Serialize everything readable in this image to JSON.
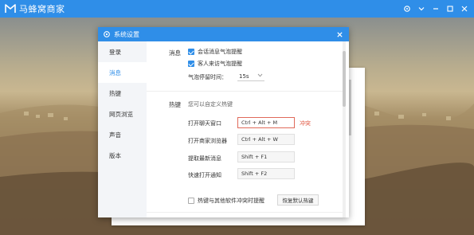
{
  "app": {
    "title": "马蜂窝商家"
  },
  "dialog": {
    "title": "系统设置"
  },
  "sidebar": {
    "items": [
      {
        "label": "登录",
        "active": false
      },
      {
        "label": "消息",
        "active": true
      },
      {
        "label": "热键",
        "active": false
      },
      {
        "label": "网页浏览",
        "active": false
      },
      {
        "label": "声音",
        "active": false
      },
      {
        "label": "版本",
        "active": false
      }
    ]
  },
  "messages": {
    "section_label": "消息",
    "option1": {
      "label": "会话消息气泡提醒",
      "checked": true
    },
    "option2": {
      "label": "客人来访气泡提醒",
      "checked": true
    },
    "bubble_time_label": "气泡停留时间：",
    "bubble_time_value": "15s"
  },
  "hotkeys": {
    "section_label": "热键",
    "hint": "您可以自定义热键",
    "rows": [
      {
        "label": "打开聊天窗口",
        "value": "Ctrl + Alt + M",
        "conflict": true
      },
      {
        "label": "打开商家浏览器",
        "value": "Ctrl + Alt + W",
        "conflict": false
      },
      {
        "label": "提取最新消息",
        "value": "Shift + F1",
        "conflict": false
      },
      {
        "label": "快速打开通知",
        "value": "Shift + F2",
        "conflict": false
      }
    ],
    "conflict_text": "冲突",
    "conflict_warn": {
      "label": "热键与其他软件冲突时提醒",
      "checked": false
    },
    "reset_label": "恢复默认热键"
  },
  "colors": {
    "accent": "#2f8ee8",
    "conflict": "#e0553f"
  }
}
